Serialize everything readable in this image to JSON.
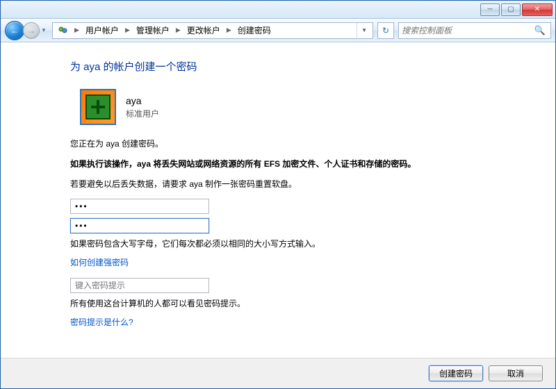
{
  "window_controls": {
    "minimize": "─",
    "maximize": "▢",
    "close": "✕"
  },
  "nav": {
    "breadcrumb": [
      "用户帐户",
      "管理帐户",
      "更改帐户",
      "创建密码"
    ],
    "search_placeholder": "搜索控制面板"
  },
  "page": {
    "title": "为 aya 的帐户创建一个密码",
    "user": {
      "name": "aya",
      "type": "标准用户"
    },
    "creating_msg": "您正在为 aya 创建密码。",
    "warning": "如果执行该操作，aya 将丢失网站或网络资源的所有 EFS 加密文件、个人证书和存储的密码。",
    "floppy_msg": "若要避免以后丢失数据，请要求 aya 制作一张密码重置软盘。",
    "pw1_value": "•••",
    "pw2_value": "•••",
    "case_note": "如果密码包含大写字母，它们每次都必须以相同的大小写方式输入。",
    "strong_link": "如何创建强密码",
    "hint_placeholder": "键入密码提示",
    "hint_note": "所有使用这台计算机的人都可以看见密码提示。",
    "hint_link": "密码提示是什么?"
  },
  "footer": {
    "create": "创建密码",
    "cancel": "取消"
  }
}
